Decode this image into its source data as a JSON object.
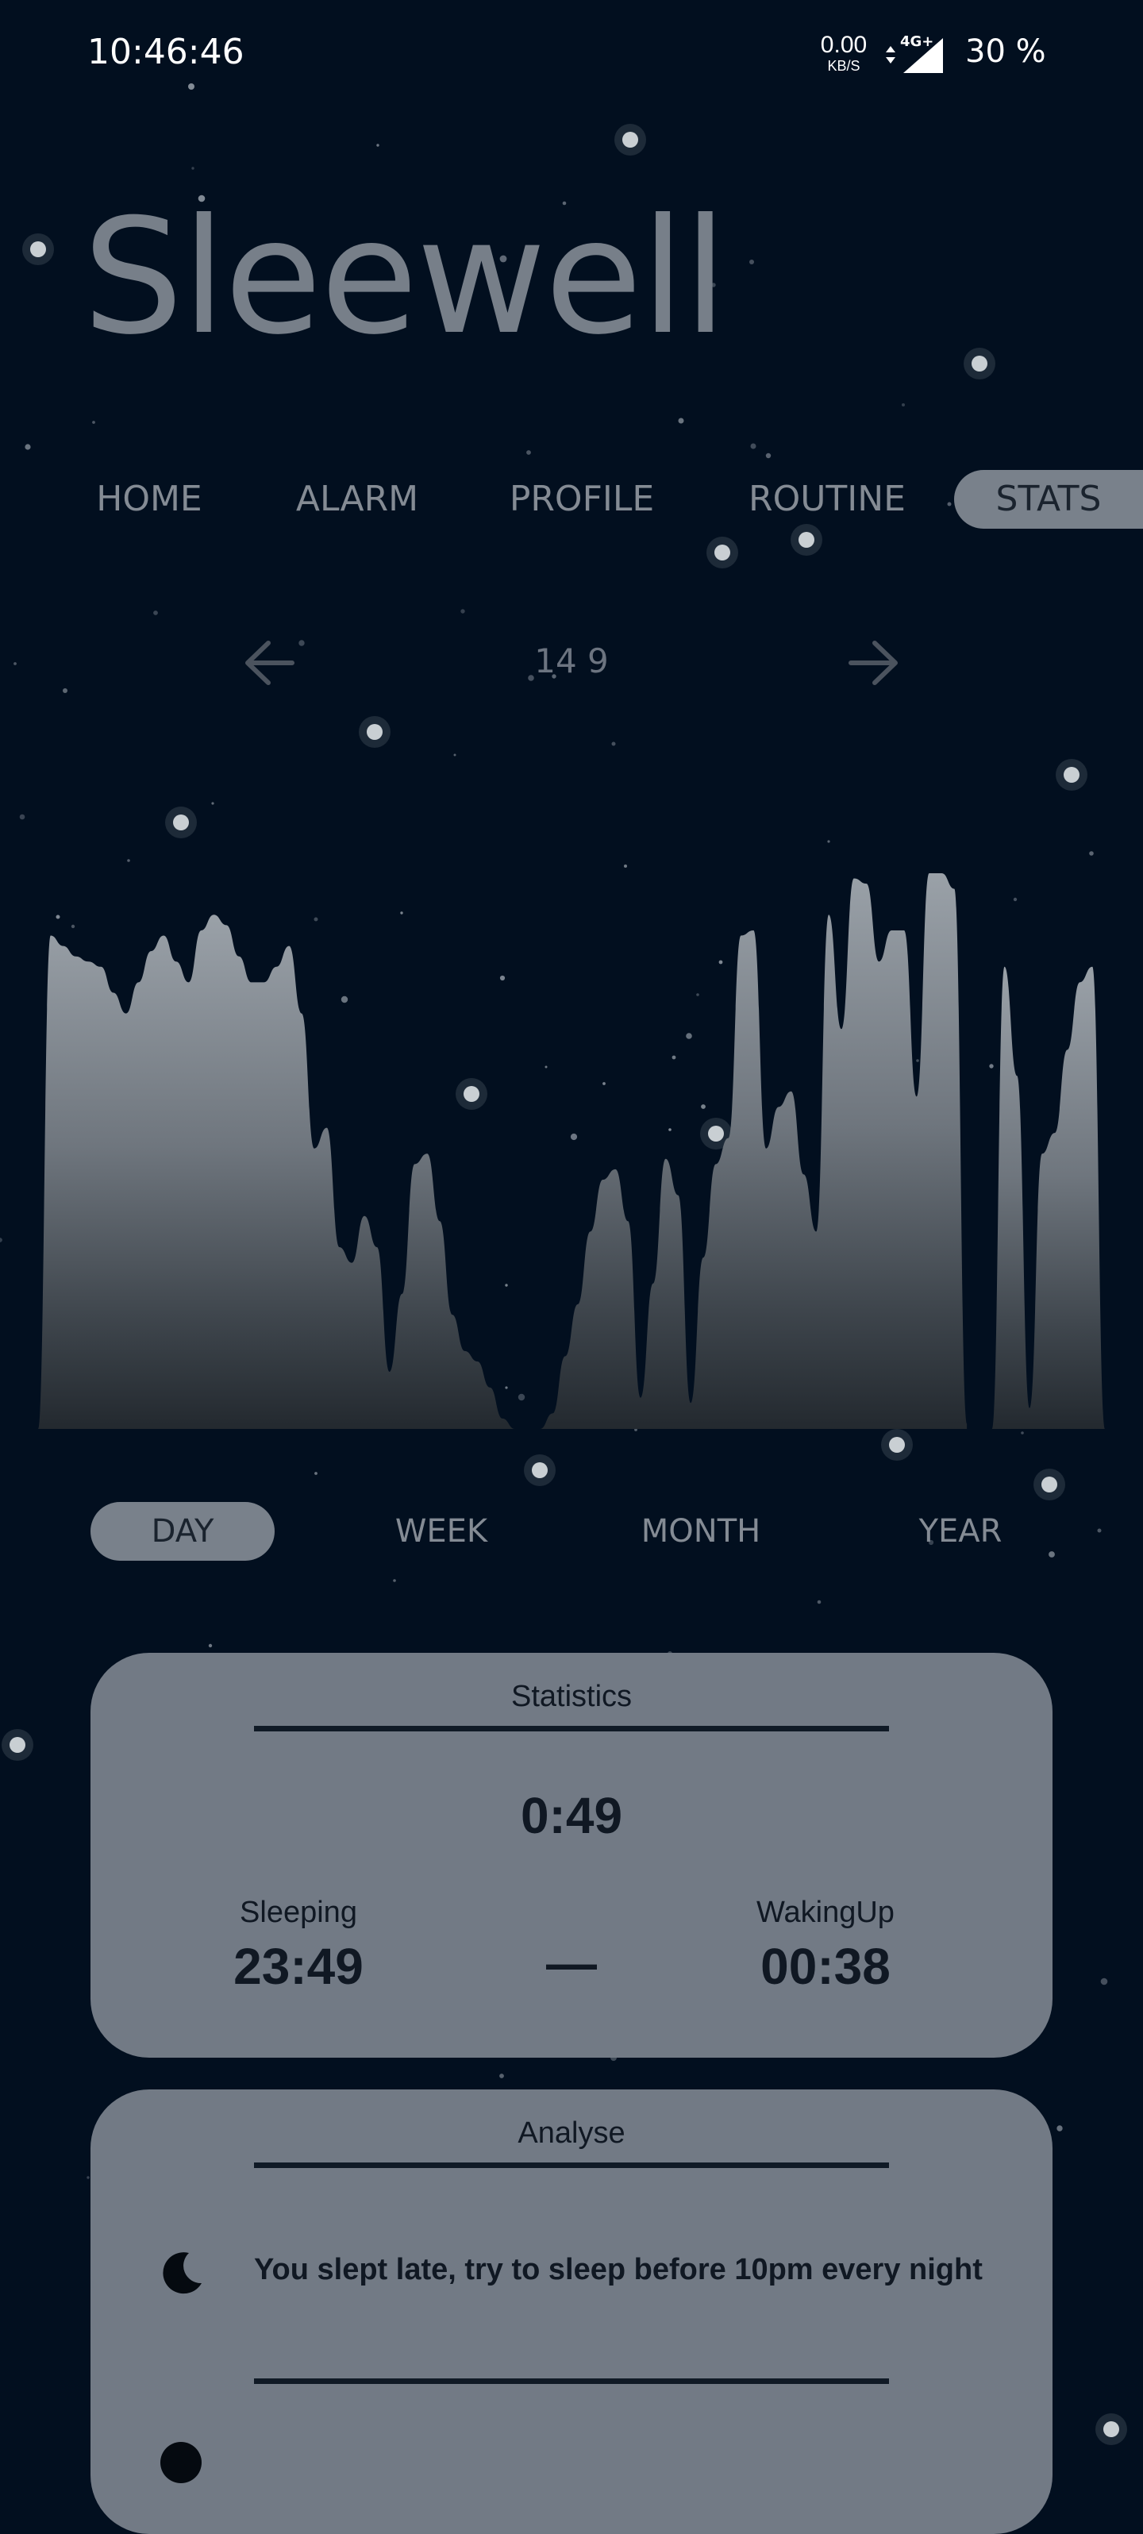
{
  "status_bar": {
    "time": "10:46:46",
    "net_speed": "0.00",
    "net_unit": "KB/S",
    "network_type": "4G+",
    "battery": "30 %"
  },
  "app": {
    "title": "Sleewell"
  },
  "nav": {
    "items": [
      "HOME",
      "ALARM",
      "PROFILE",
      "ROUTINE",
      "STATS"
    ],
    "active": "STATS"
  },
  "date_nav": {
    "label": "14 9",
    "prev_icon": "arrow-left-icon",
    "next_icon": "arrow-right-icon"
  },
  "chart_data": {
    "type": "area",
    "title": "",
    "xlabel": "",
    "ylabel": "",
    "series": [
      {
        "values": [
          0.0,
          0.95,
          0.93,
          0.91,
          0.9,
          0.89,
          0.84,
          0.8,
          0.86,
          0.92,
          0.95,
          0.9,
          0.86,
          0.96,
          0.99,
          0.97,
          0.91,
          0.86,
          0.86,
          0.89,
          0.93,
          0.8,
          0.54,
          0.58,
          0.35,
          0.32,
          0.41,
          0.35,
          0.11,
          0.26,
          0.51,
          0.53,
          0.4,
          0.22,
          0.15,
          0.13,
          0.08,
          0.02,
          0.0,
          null,
          0.0,
          0.03,
          0.14,
          0.24,
          0.38,
          0.48,
          0.5,
          0.4,
          0.06,
          0.28,
          0.52,
          0.45,
          0.05,
          0.33,
          0.51,
          0.56,
          0.95,
          0.96,
          0.54,
          0.62,
          0.65,
          0.49,
          0.38,
          0.99,
          0.77,
          1.06,
          1.05,
          0.9,
          0.96,
          0.96,
          0.64,
          1.07,
          1.07,
          1.04,
          0.01,
          null,
          0.0,
          0.89,
          0.68,
          0.04,
          0.53,
          0.57,
          0.73,
          0.86,
          0.89,
          0.0
        ]
      }
    ]
  },
  "periods": {
    "items": [
      "DAY",
      "WEEK",
      "MONTH",
      "YEAR"
    ],
    "active": "DAY"
  },
  "statistics": {
    "title": "Statistics",
    "duration": "0:49",
    "sleeping_label": "Sleeping",
    "sleeping_time": "23:49",
    "separator": "—",
    "waking_label": "WakingUp",
    "waking_time": "00:38"
  },
  "analyse": {
    "title": "Analyse",
    "items": [
      {
        "icon": "moon-icon",
        "text": "You slept late, try to sleep before 10pm every night"
      }
    ]
  }
}
